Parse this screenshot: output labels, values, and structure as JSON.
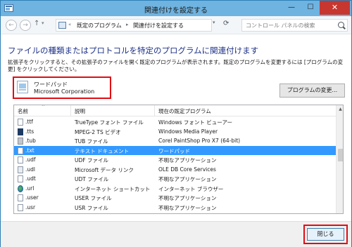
{
  "window": {
    "title": "関連付けを設定する",
    "min_glyph": "—",
    "max_glyph": "☐",
    "close_glyph": "✕"
  },
  "address_bar": {
    "back_glyph": "←",
    "forward_glyph": "→",
    "up_glyph": "↑",
    "chevron": "«",
    "breadcrumb": [
      "既定のプログラム",
      "関連付けを設定する"
    ],
    "separator": "▸",
    "dropdown_glyph": "▾",
    "refresh_glyph": "⟳",
    "search_placeholder": "コントロール パネルの検索"
  },
  "main": {
    "heading": "ファイルの種類またはプロトコルを特定のプログラムに関連付けます",
    "description": "拡張子をクリックすると、その拡張子のファイルを開く既定のプログラムが表示されます。既定のプログラムを変更するには [プログラムの変更] をクリックしてください。",
    "current_program": {
      "name": "ワードパッド",
      "company": "Microsoft Corporation"
    },
    "change_button": "プログラムの変更..."
  },
  "list": {
    "columns": [
      "名前",
      "説明",
      "現在の既定プログラム"
    ],
    "sort_glyph": "^",
    "rows": [
      {
        "ext": ".ttf",
        "desc": "TrueType フォント ファイル",
        "prog": "Windows フォント ビューアー",
        "icon": "font-file-icon",
        "selected": false
      },
      {
        "ext": ".tts",
        "desc": "MPEG-2 TS ビデオ",
        "prog": "Windows Media Player",
        "icon": "video-file-icon",
        "selected": false
      },
      {
        "ext": ".tub",
        "desc": "TUB ファイル",
        "prog": "Corel PaintShop Pro X7 (64-bit)",
        "icon": "paintshop-file-icon",
        "selected": false
      },
      {
        "ext": ".txt",
        "desc": "テキスト ドキュメント",
        "prog": "ワードパッド",
        "icon": "text-file-icon",
        "selected": true
      },
      {
        "ext": ".udf",
        "desc": "UDF ファイル",
        "prog": "不明なアプリケーション",
        "icon": "generic-file-icon",
        "selected": false
      },
      {
        "ext": ".udl",
        "desc": "Microsoft データ リンク",
        "prog": "OLE DB Core Services",
        "icon": "data-link-file-icon",
        "selected": false
      },
      {
        "ext": ".udt",
        "desc": "UDT ファイル",
        "prog": "不明なアプリケーション",
        "icon": "generic-file-icon",
        "selected": false
      },
      {
        "ext": ".url",
        "desc": "インターネット ショートカット",
        "prog": "インターネット ブラウザー",
        "icon": "globe-icon",
        "selected": false
      },
      {
        "ext": ".user",
        "desc": "USER ファイル",
        "prog": "不明なアプリケーション",
        "icon": "generic-file-icon",
        "selected": false
      },
      {
        "ext": ".usr",
        "desc": "USR ファイル",
        "prog": "不明なアプリケーション",
        "icon": "generic-file-icon",
        "selected": false
      }
    ],
    "scroll_up_glyph": "▲"
  },
  "footer": {
    "close_button": "閉じる",
    "grip_glyph": "⋰"
  },
  "colors": {
    "heading": "#1e3287",
    "selection": "#3399ff",
    "highlight_box": "#e00d14",
    "titlebar": "#6fb3e0",
    "close_button": "#c7372f"
  }
}
